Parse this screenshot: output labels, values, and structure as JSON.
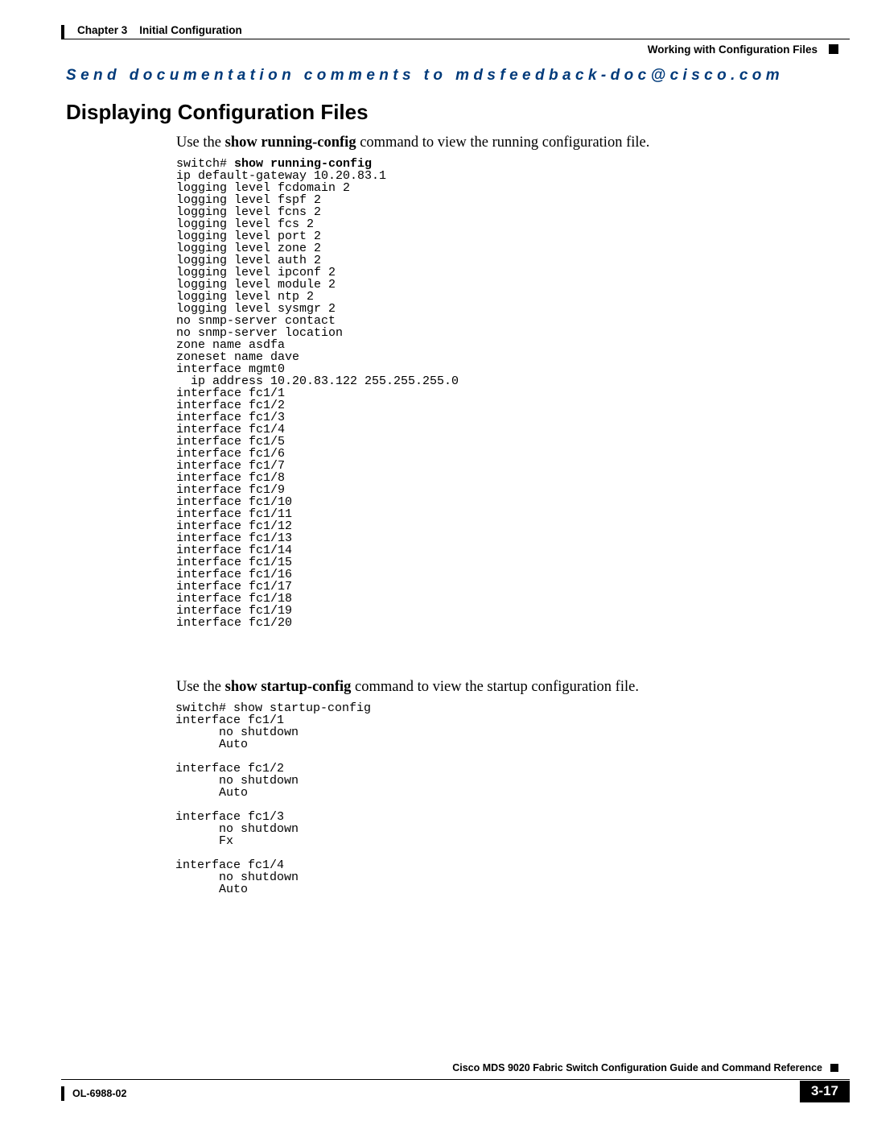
{
  "header": {
    "chapter_label": "Chapter 3",
    "chapter_title": "Initial Configuration",
    "section_right": "Working with Configuration Files"
  },
  "feedback": "Send documentation comments to mdsfeedback-doc@cisco.com",
  "heading": "Displaying Configuration Files",
  "para1_prefix": "Use the ",
  "para1_bold": "show running-config",
  "para1_suffix": " command to view the running configuration file.",
  "code1_prompt": "switch# ",
  "code1_cmd": "show running-config",
  "code1_body": "ip default-gateway 10.20.83.1\nlogging level fcdomain 2\nlogging level fspf 2\nlogging level fcns 2\nlogging level fcs 2\nlogging level port 2\nlogging level zone 2\nlogging level auth 2\nlogging level ipconf 2\nlogging level module 2\nlogging level ntp 2\nlogging level sysmgr 2\nno snmp-server contact\nno snmp-server location\nzone name asdfa\nzoneset name dave\ninterface mgmt0\n  ip address 10.20.83.122 255.255.255.0\ninterface fc1/1\ninterface fc1/2\ninterface fc1/3\ninterface fc1/4\ninterface fc1/5\ninterface fc1/6\ninterface fc1/7\ninterface fc1/8\ninterface fc1/9\ninterface fc1/10\ninterface fc1/11\ninterface fc1/12\ninterface fc1/13\ninterface fc1/14\ninterface fc1/15\ninterface fc1/16\ninterface fc1/17\ninterface fc1/18\ninterface fc1/19\ninterface fc1/20",
  "para2_prefix": "Use the ",
  "para2_bold": "show startup-config",
  "para2_suffix": " command to view the startup configuration file.",
  "code2_prompt": "switch# ",
  "code2_cmd": "show startup-config",
  "code2_body": "interface fc1/1\n      no shutdown\n      Auto\n\ninterface fc1/2\n      no shutdown\n      Auto\n\ninterface fc1/3\n      no shutdown\n      Fx\n\ninterface fc1/4\n      no shutdown\n      Auto",
  "footer": {
    "doc_title": "Cisco MDS 9020 Fabric Switch Configuration Guide and Command Reference",
    "ol": "OL-6988-02",
    "page_num": "3-17"
  }
}
